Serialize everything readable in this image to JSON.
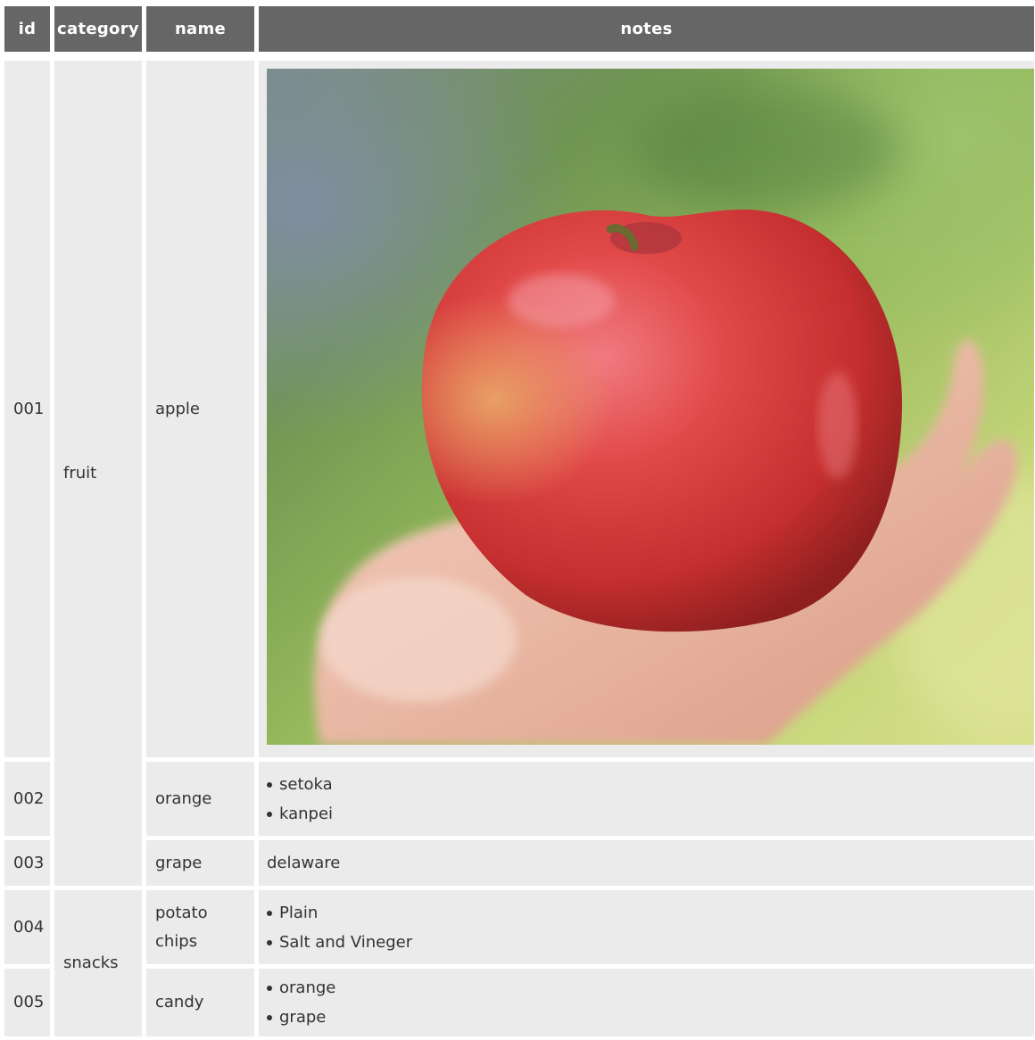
{
  "headers": {
    "id": "id",
    "category": "category",
    "name": "name",
    "notes": "notes"
  },
  "rows": [
    {
      "id": "001",
      "name": "apple",
      "notes_type": "image",
      "image": "apple-in-hand-photo"
    },
    {
      "id": "002",
      "name": "orange",
      "notes_list": [
        "setoka",
        "kanpei"
      ]
    },
    {
      "id": "003",
      "name": "grape",
      "notes_text": "delaware"
    },
    {
      "id": "004",
      "name_lines": [
        "potato",
        "chips"
      ],
      "notes_list": [
        "Plain",
        "Salt and Vineger"
      ]
    },
    {
      "id": "005",
      "name": "candy",
      "notes_list": [
        "orange",
        "grape"
      ]
    }
  ],
  "categories": {
    "fruit": "fruit",
    "snacks": "snacks"
  },
  "colors": {
    "header_bg": "#666666",
    "header_text": "#ffffff",
    "cell_bg": "#ebebeb",
    "text": "#333333"
  }
}
